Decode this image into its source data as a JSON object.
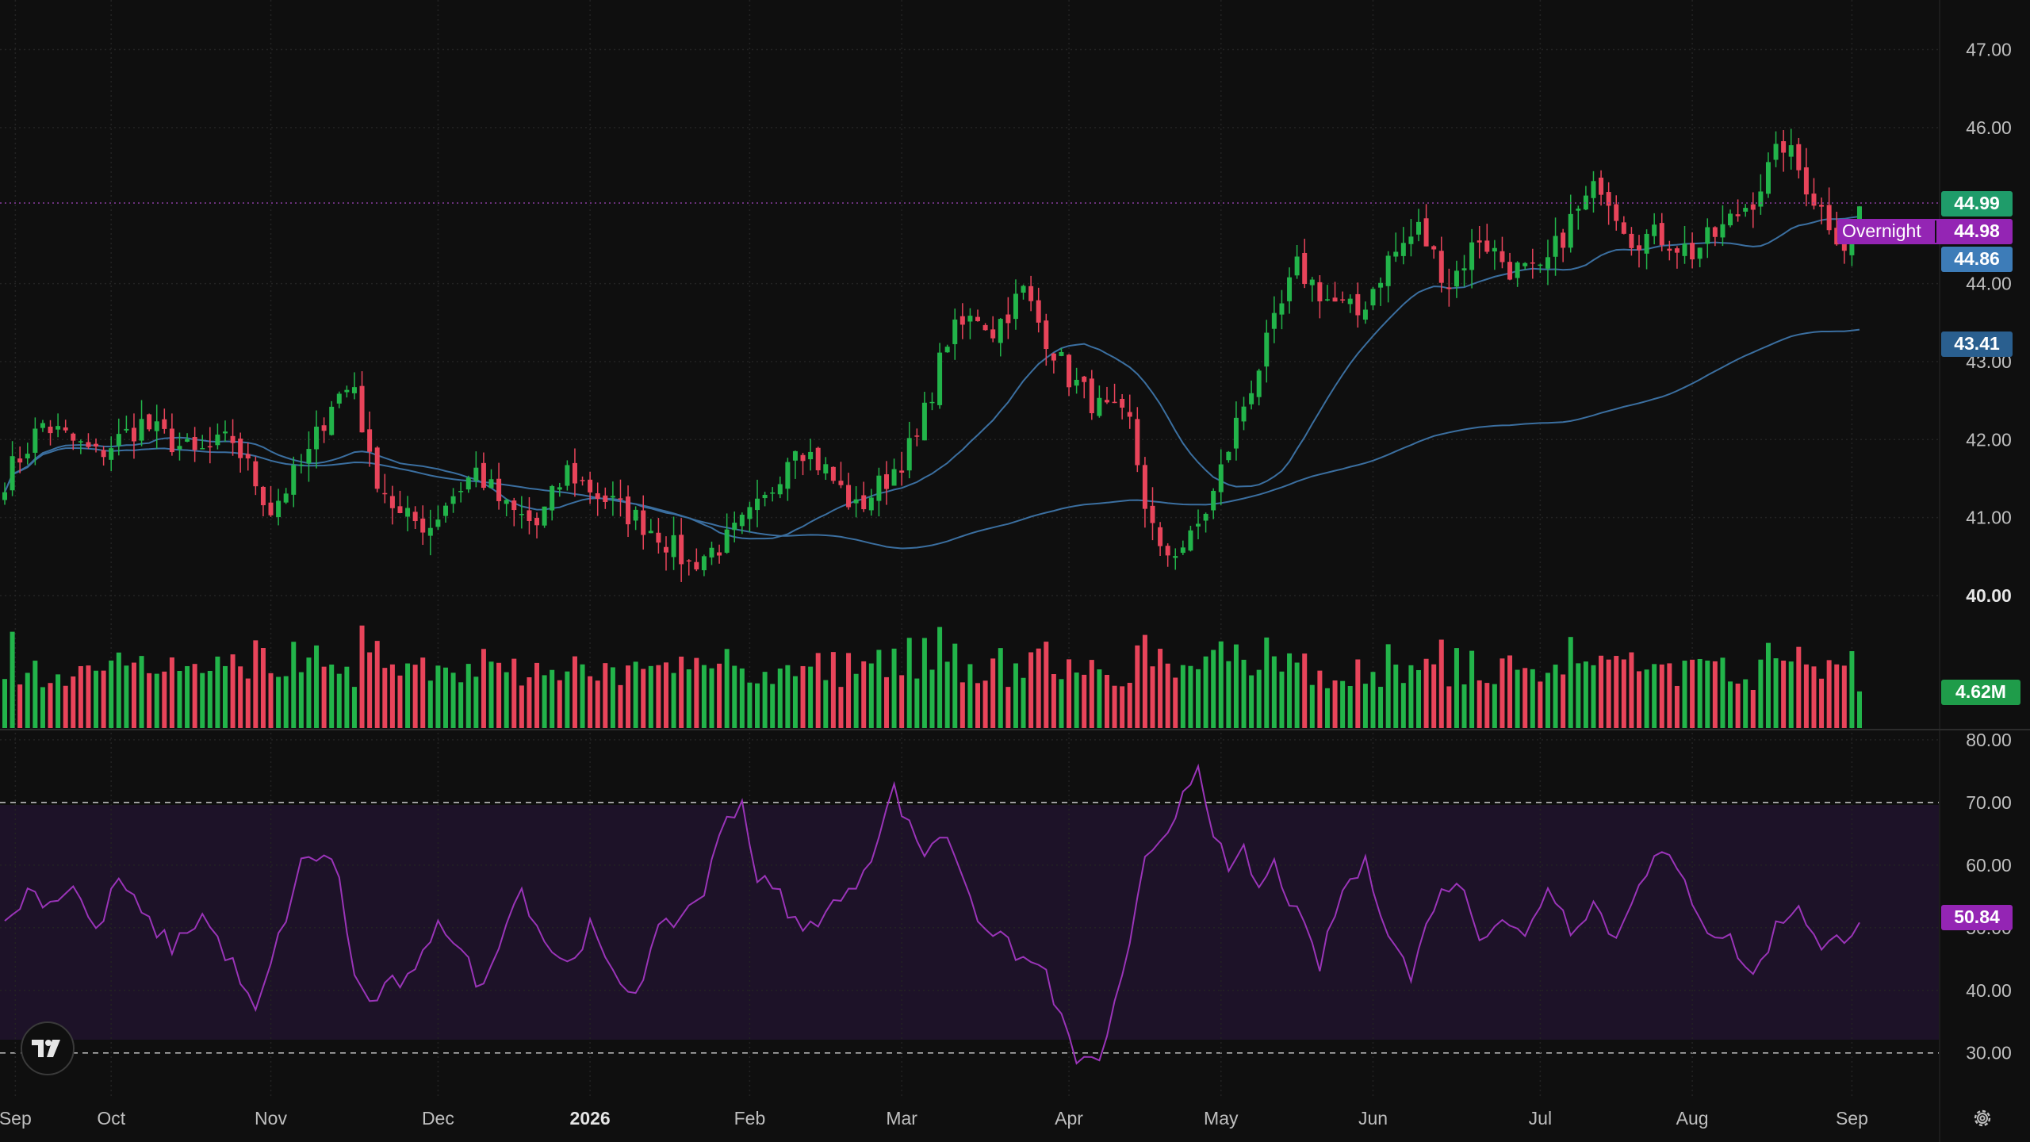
{
  "colors": {
    "background": "#0f0f0f",
    "grid": "#232323",
    "up": "#22b44a",
    "down": "#e8445a",
    "ma_line": "#3b6fa0",
    "rsi_line": "#9a34b8",
    "rsi_band": "#1d1228",
    "last_price_tag": "#1f9c6a",
    "overnight_tag": "#9425b4",
    "ma_tag": "#3d7cb8",
    "volume_tag": "#1f9c4a"
  },
  "logo": {
    "icon": "tradingview-logo-icon"
  },
  "settings": {
    "icon": "gear-icon"
  },
  "price_tags": {
    "last": "44.99",
    "overnight_label": "Overnight",
    "overnight": "44.98",
    "ma_short": "44.86",
    "ma_long": "43.41",
    "volume": "4.62M",
    "rsi": "50.84"
  },
  "chart_data": [
    {
      "type": "candlestick",
      "price_axis": {
        "ticks": [
          "47.00",
          "46.00",
          "44.00",
          "43.00",
          "42.00",
          "41.00",
          "40.00"
        ],
        "range": [
          39.4,
          47.3
        ]
      },
      "time_axis": {
        "ticks": [
          "Sep",
          "Oct",
          "Nov",
          "Dec",
          "2026",
          "Feb",
          "Mar",
          "Apr",
          "May",
          "Jun",
          "Jul",
          "Aug",
          "Sep"
        ]
      },
      "grid": true,
      "trading_days": 245,
      "close_anchors": [
        [
          0,
          41.5
        ],
        [
          5,
          42.2
        ],
        [
          12,
          41.8
        ],
        [
          18,
          42.2
        ],
        [
          25,
          41.8
        ],
        [
          30,
          42.0
        ],
        [
          35,
          41.1
        ],
        [
          40,
          41.8
        ],
        [
          43,
          42.5
        ],
        [
          46,
          42.7
        ],
        [
          48,
          41.7
        ],
        [
          52,
          41.0
        ],
        [
          56,
          40.9
        ],
        [
          58,
          41.2
        ],
        [
          62,
          41.6
        ],
        [
          66,
          41.1
        ],
        [
          70,
          40.9
        ],
        [
          74,
          41.6
        ],
        [
          78,
          41.3
        ],
        [
          86,
          40.8
        ],
        [
          90,
          40.4
        ],
        [
          95,
          40.7
        ],
        [
          100,
          41.2
        ],
        [
          104,
          42.0
        ],
        [
          108,
          41.6
        ],
        [
          112,
          41.1
        ],
        [
          116,
          41.5
        ],
        [
          120,
          42.0
        ],
        [
          124,
          43.3
        ],
        [
          128,
          43.6
        ],
        [
          130,
          43.4
        ],
        [
          134,
          43.9
        ],
        [
          136,
          43.5
        ],
        [
          140,
          42.8
        ],
        [
          144,
          42.4
        ],
        [
          148,
          42.2
        ],
        [
          150,
          41.2
        ],
        [
          152,
          40.5
        ],
        [
          156,
          40.7
        ],
        [
          159,
          41.3
        ],
        [
          162,
          42.2
        ],
        [
          166,
          43.2
        ],
        [
          170,
          44.2
        ],
        [
          174,
          43.8
        ],
        [
          178,
          43.6
        ],
        [
          182,
          44.3
        ],
        [
          186,
          44.7
        ],
        [
          190,
          44.0
        ],
        [
          194,
          44.6
        ],
        [
          198,
          44.2
        ],
        [
          202,
          44.1
        ],
        [
          206,
          44.8
        ],
        [
          210,
          45.3
        ],
        [
          214,
          44.6
        ],
        [
          218,
          44.6
        ],
        [
          222,
          44.4
        ],
        [
          226,
          44.7
        ],
        [
          230,
          45.1
        ],
        [
          234,
          45.8
        ],
        [
          238,
          45.1
        ],
        [
          242,
          44.5
        ],
        [
          244,
          44.99
        ]
      ],
      "volume_range": [
        0,
        18000000
      ],
      "overlays": [
        {
          "type": "moving_average",
          "last_value": 44.86
        },
        {
          "type": "moving_average",
          "last_value": 43.41
        }
      ],
      "last_price": 44.99,
      "overnight_price": 44.98,
      "last_volume": "4.62M"
    },
    {
      "type": "line",
      "indicator": "RSI",
      "y_axis": {
        "ticks": [
          "80.00",
          "70.00",
          "60.00",
          "50.00",
          "40.00",
          "30.00"
        ],
        "range": [
          23,
          81
        ]
      },
      "band": [
        30,
        70
      ],
      "anchors": [
        [
          0,
          50
        ],
        [
          3,
          56
        ],
        [
          6,
          54
        ],
        [
          9,
          57
        ],
        [
          12,
          49
        ],
        [
          15,
          58
        ],
        [
          18,
          52
        ],
        [
          22,
          47
        ],
        [
          26,
          52
        ],
        [
          30,
          44
        ],
        [
          33,
          36
        ],
        [
          36,
          48
        ],
        [
          39,
          60
        ],
        [
          42,
          62
        ],
        [
          44,
          58
        ],
        [
          46,
          42
        ],
        [
          48,
          38
        ],
        [
          51,
          41
        ],
        [
          54,
          42
        ],
        [
          57,
          52
        ],
        [
          60,
          46
        ],
        [
          63,
          40
        ],
        [
          66,
          52
        ],
        [
          68,
          56
        ],
        [
          71,
          48
        ],
        [
          74,
          44
        ],
        [
          77,
          50
        ],
        [
          80,
          42
        ],
        [
          83,
          40
        ],
        [
          86,
          49
        ],
        [
          89,
          52
        ],
        [
          92,
          56
        ],
        [
          95,
          68
        ],
        [
          97,
          70
        ],
        [
          99,
          58
        ],
        [
          102,
          55
        ],
        [
          105,
          49
        ],
        [
          108,
          53
        ],
        [
          111,
          55
        ],
        [
          114,
          62
        ],
        [
          117,
          72
        ],
        [
          119,
          66
        ],
        [
          121,
          62
        ],
        [
          123,
          65
        ],
        [
          125,
          62
        ],
        [
          128,
          52
        ],
        [
          131,
          48
        ],
        [
          134,
          45
        ],
        [
          137,
          43
        ],
        [
          139,
          35
        ],
        [
          141,
          29
        ],
        [
          143,
          28
        ],
        [
          145,
          32
        ],
        [
          148,
          48
        ],
        [
          150,
          60
        ],
        [
          153,
          64
        ],
        [
          155,
          72
        ],
        [
          157,
          76
        ],
        [
          159,
          66
        ],
        [
          161,
          58
        ],
        [
          163,
          62
        ],
        [
          165,
          56
        ],
        [
          167,
          60
        ],
        [
          170,
          52
        ],
        [
          173,
          44
        ],
        [
          176,
          56
        ],
        [
          179,
          60
        ],
        [
          182,
          50
        ],
        [
          185,
          42
        ],
        [
          188,
          54
        ],
        [
          191,
          58
        ],
        [
          194,
          49
        ],
        [
          197,
          52
        ],
        [
          200,
          48
        ],
        [
          203,
          57
        ],
        [
          206,
          50
        ],
        [
          209,
          54
        ],
        [
          212,
          48
        ],
        [
          215,
          58
        ],
        [
          218,
          62
        ],
        [
          221,
          57
        ],
        [
          224,
          50
        ],
        [
          227,
          48
        ],
        [
          230,
          42
        ],
        [
          233,
          50
        ],
        [
          236,
          54
        ],
        [
          239,
          46
        ],
        [
          241,
          48
        ],
        [
          244,
          50.84
        ]
      ],
      "last_value": 50.84
    }
  ]
}
